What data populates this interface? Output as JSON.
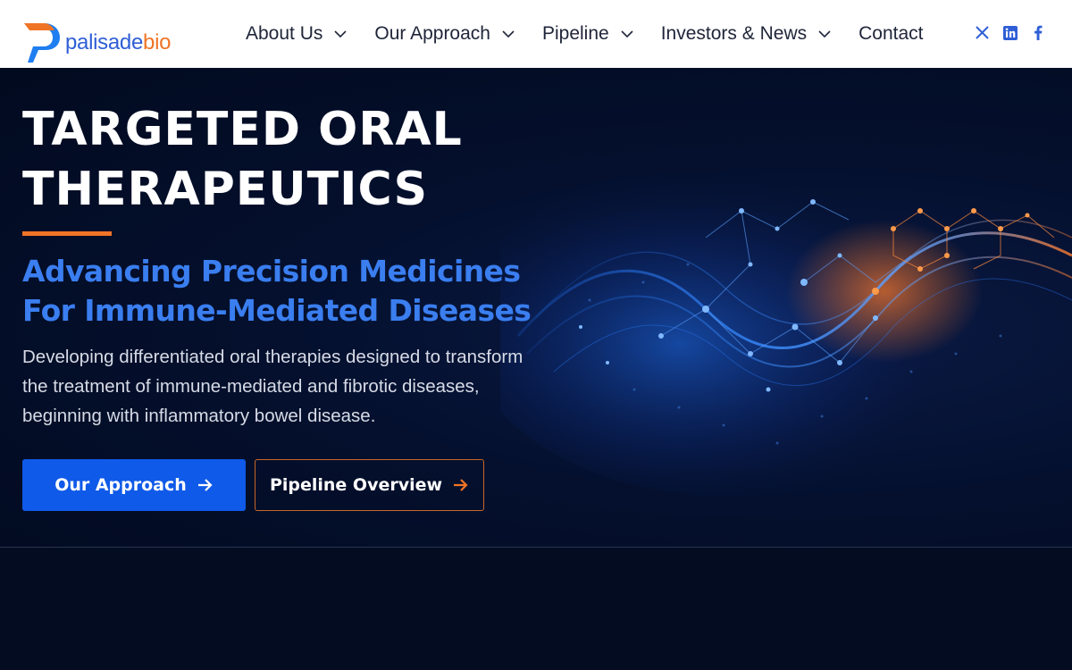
{
  "brand": {
    "name_part1": "palisade",
    "name_part2": "bio",
    "primary_color": "#2f5fd6",
    "accent_color": "#f07426"
  },
  "nav": {
    "items": [
      {
        "label": "About Us",
        "has_dropdown": true
      },
      {
        "label": "Our Approach",
        "has_dropdown": true
      },
      {
        "label": "Pipeline",
        "has_dropdown": true
      },
      {
        "label": "Investors & News",
        "has_dropdown": true
      },
      {
        "label": "Contact",
        "has_dropdown": false
      }
    ]
  },
  "socials": [
    {
      "icon": "x-icon"
    },
    {
      "icon": "linkedin-icon"
    },
    {
      "icon": "facebook-icon"
    }
  ],
  "hero": {
    "title_line1": "TARGETED ORAL",
    "title_line2": "THERAPEUTICS",
    "subtitle_line1": "Advancing Precision Medicines",
    "subtitle_line2": "For Immune-Mediated Diseases",
    "description": "Developing differentiated oral therapies designed to transform the treatment of immune-mediated and fibrotic diseases, beginning with inflammatory bowel disease.",
    "primary_button": "Our Approach",
    "secondary_button": "Pipeline Overview"
  },
  "colors": {
    "hero_bg": "#030b22",
    "button_blue": "#0f5ae8",
    "orange": "#f07426",
    "subtitle_blue": "#3a7ef0"
  }
}
